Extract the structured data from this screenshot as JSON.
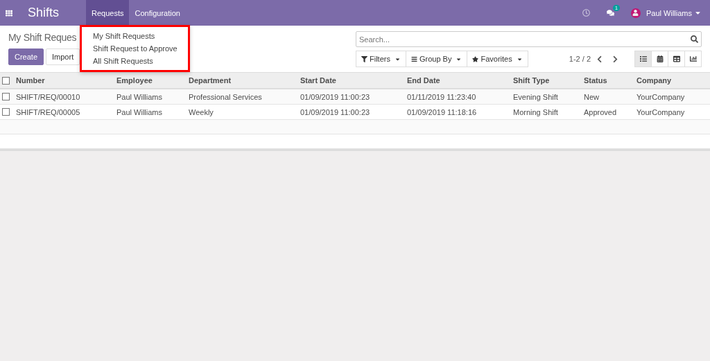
{
  "navbar": {
    "app_title": "Shifts",
    "menus": [
      {
        "label": "Requests",
        "selected": true
      },
      {
        "label": "Configuration",
        "selected": false
      }
    ],
    "messages_badge": "1",
    "user": "Paul Williams"
  },
  "dropdown": {
    "items": [
      "My Shift Requests",
      "Shift Request to Approve",
      "All Shift Requests"
    ],
    "highlighted": true
  },
  "control_panel": {
    "title": "My Shift Reques",
    "buttons": [
      {
        "label": "Create",
        "kind": "primary"
      },
      {
        "label": "Import",
        "kind": "secondary"
      }
    ],
    "search": {
      "placeholder": "Search..."
    },
    "filters": [
      "Filters",
      "Group By",
      "Favorites"
    ],
    "pager": "1-2 / 2",
    "views": [
      {
        "kind": "list",
        "selected": true
      },
      {
        "kind": "calendar",
        "selected": false
      },
      {
        "kind": "pivot",
        "selected": false
      },
      {
        "kind": "graph",
        "selected": false
      }
    ]
  },
  "table": {
    "select_all_checked": false,
    "columns": [
      "Number",
      "Employee",
      "Department",
      "Start Date",
      "End Date",
      "Shift Type",
      "Status",
      "Company"
    ],
    "rows": [
      {
        "checked": false,
        "cells": [
          "SHIFT/REQ/00010",
          "Paul Williams",
          "Professional Services",
          "01/09/2019 11:00:23",
          "01/11/2019 11:23:40",
          "Evening Shift",
          "New",
          "YourCompany"
        ]
      },
      {
        "checked": false,
        "cells": [
          "SHIFT/REQ/00005",
          "Paul Williams",
          "Weekly",
          "01/09/2019 11:00:23",
          "01/09/2019 11:18:16",
          "Morning Shift",
          "Approved",
          "YourCompany"
        ]
      }
    ]
  }
}
